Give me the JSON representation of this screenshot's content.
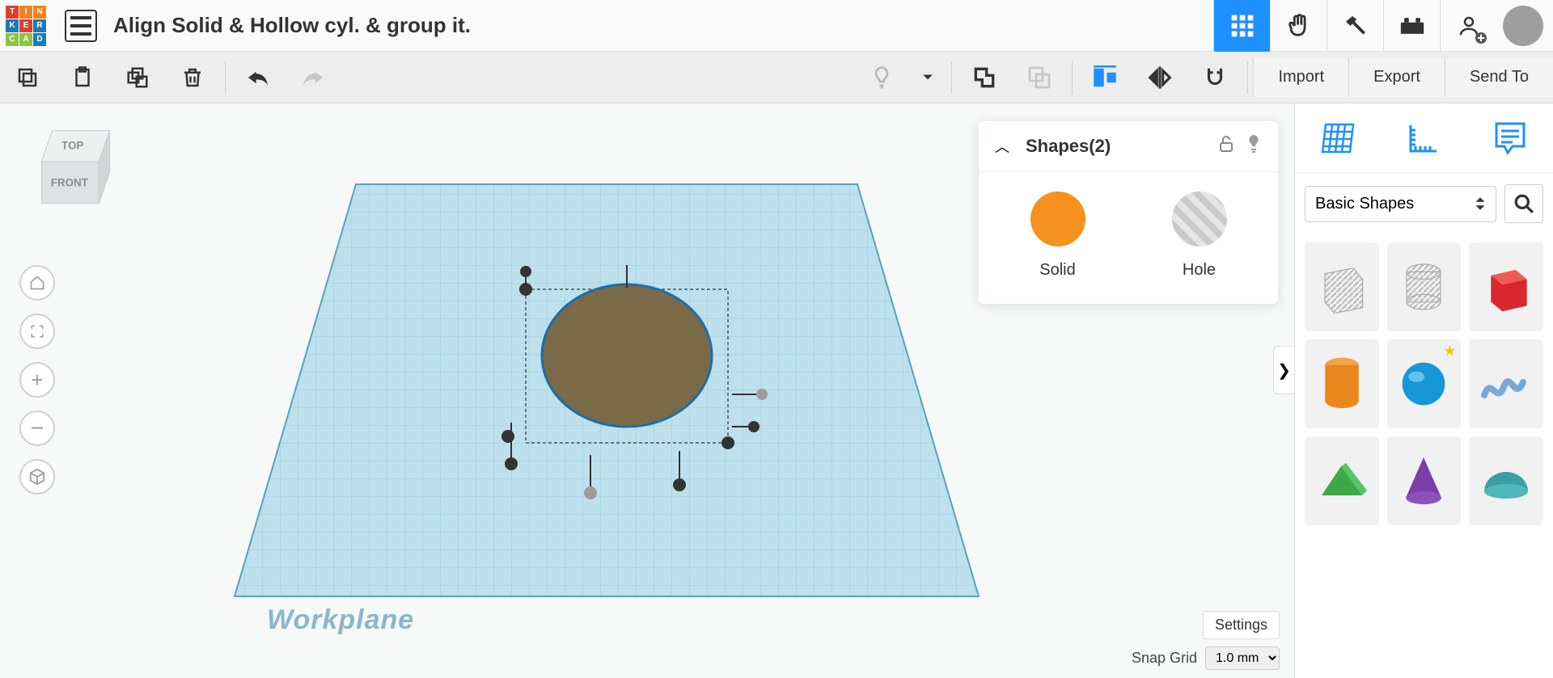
{
  "header": {
    "project_title": "Align Solid & Hollow cyl. & group it."
  },
  "toolbar": {
    "import_label": "Import",
    "export_label": "Export",
    "send_to_label": "Send To"
  },
  "viewcube": {
    "top": "TOP",
    "front": "FRONT"
  },
  "workplane": {
    "label": "Workplane"
  },
  "inspector": {
    "title": "Shapes(2)",
    "solid_label": "Solid",
    "hole_label": "Hole"
  },
  "bottom": {
    "settings_label": "Settings",
    "snap_label": "Snap Grid",
    "snap_value": "1.0 mm"
  },
  "sidebar": {
    "category": "Basic Shapes",
    "collapse_glyph": "❯",
    "shapes": [
      {
        "name": "box-hole",
        "type": "hole"
      },
      {
        "name": "cylinder-hole",
        "type": "hole"
      },
      {
        "name": "box",
        "color": "#d8272d"
      },
      {
        "name": "cylinder",
        "color": "#e9861c"
      },
      {
        "name": "sphere",
        "color": "#1797d5",
        "starred": true
      },
      {
        "name": "scribble",
        "color": "#7aa8d8"
      },
      {
        "name": "roof",
        "color": "#3fa845"
      },
      {
        "name": "cone",
        "color": "#7a3fa8"
      },
      {
        "name": "half-sphere",
        "color": "#3aa0a4"
      }
    ]
  },
  "colors": {
    "accent": "#1e90ff"
  }
}
